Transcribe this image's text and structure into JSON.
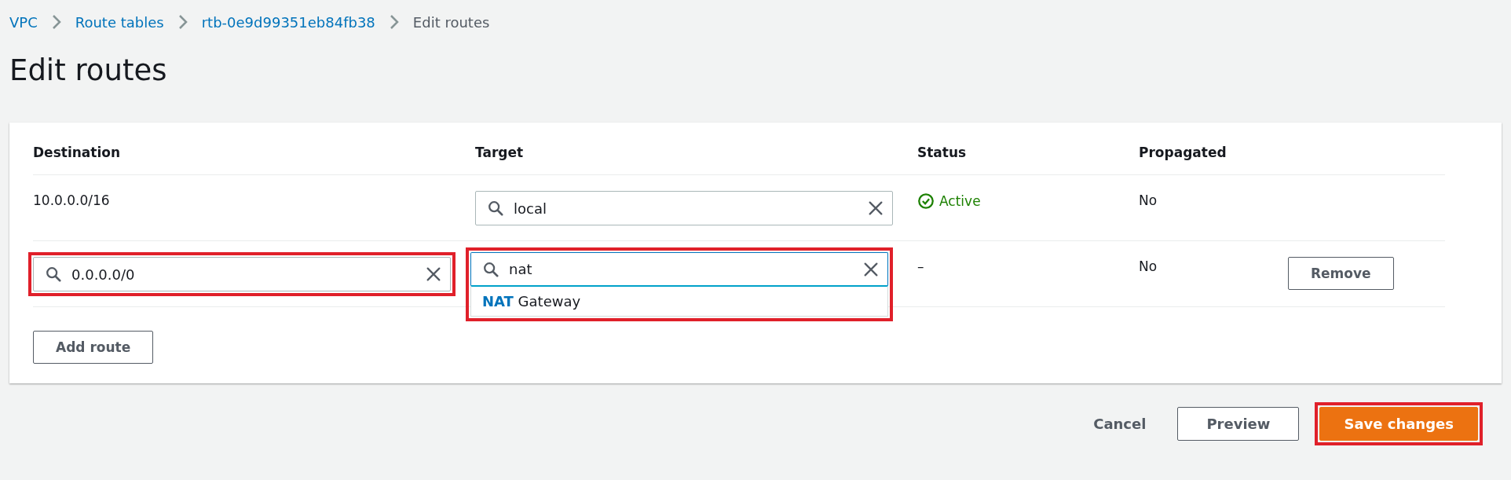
{
  "breadcrumbs": [
    {
      "label": "VPC",
      "link": true
    },
    {
      "label": "Route tables",
      "link": true
    },
    {
      "label": "rtb-0e9d99351eb84fb38",
      "link": true
    },
    {
      "label": "Edit routes",
      "link": false
    }
  ],
  "title": "Edit routes",
  "table": {
    "columns": [
      "Destination",
      "Target",
      "Status",
      "Propagated"
    ],
    "rows": [
      {
        "destination": {
          "kind": "text",
          "value": "10.0.0.0/16",
          "highlighted": false
        },
        "target": {
          "value": "local",
          "focused": false,
          "highlighted": false
        },
        "status": {
          "kind": "active",
          "label": "Active"
        },
        "propagated": "No"
      },
      {
        "destination": {
          "kind": "input",
          "value": "0.0.0.0/0",
          "highlighted": true
        },
        "target": {
          "value": "nat",
          "focused": true,
          "highlighted": true,
          "options": [
            "**NAT** Gateway"
          ]
        },
        "status": {
          "kind": "none",
          "label": "–"
        },
        "propagated": "No",
        "remove": "Remove"
      }
    ]
  },
  "add_button": "Add route",
  "footer": [
    {
      "kind": "link",
      "label": "Cancel",
      "highlighted": false
    },
    {
      "kind": "normal",
      "label": "Preview",
      "highlighted": false
    },
    {
      "kind": "primary",
      "label": "Save changes",
      "highlighted": true
    }
  ]
}
